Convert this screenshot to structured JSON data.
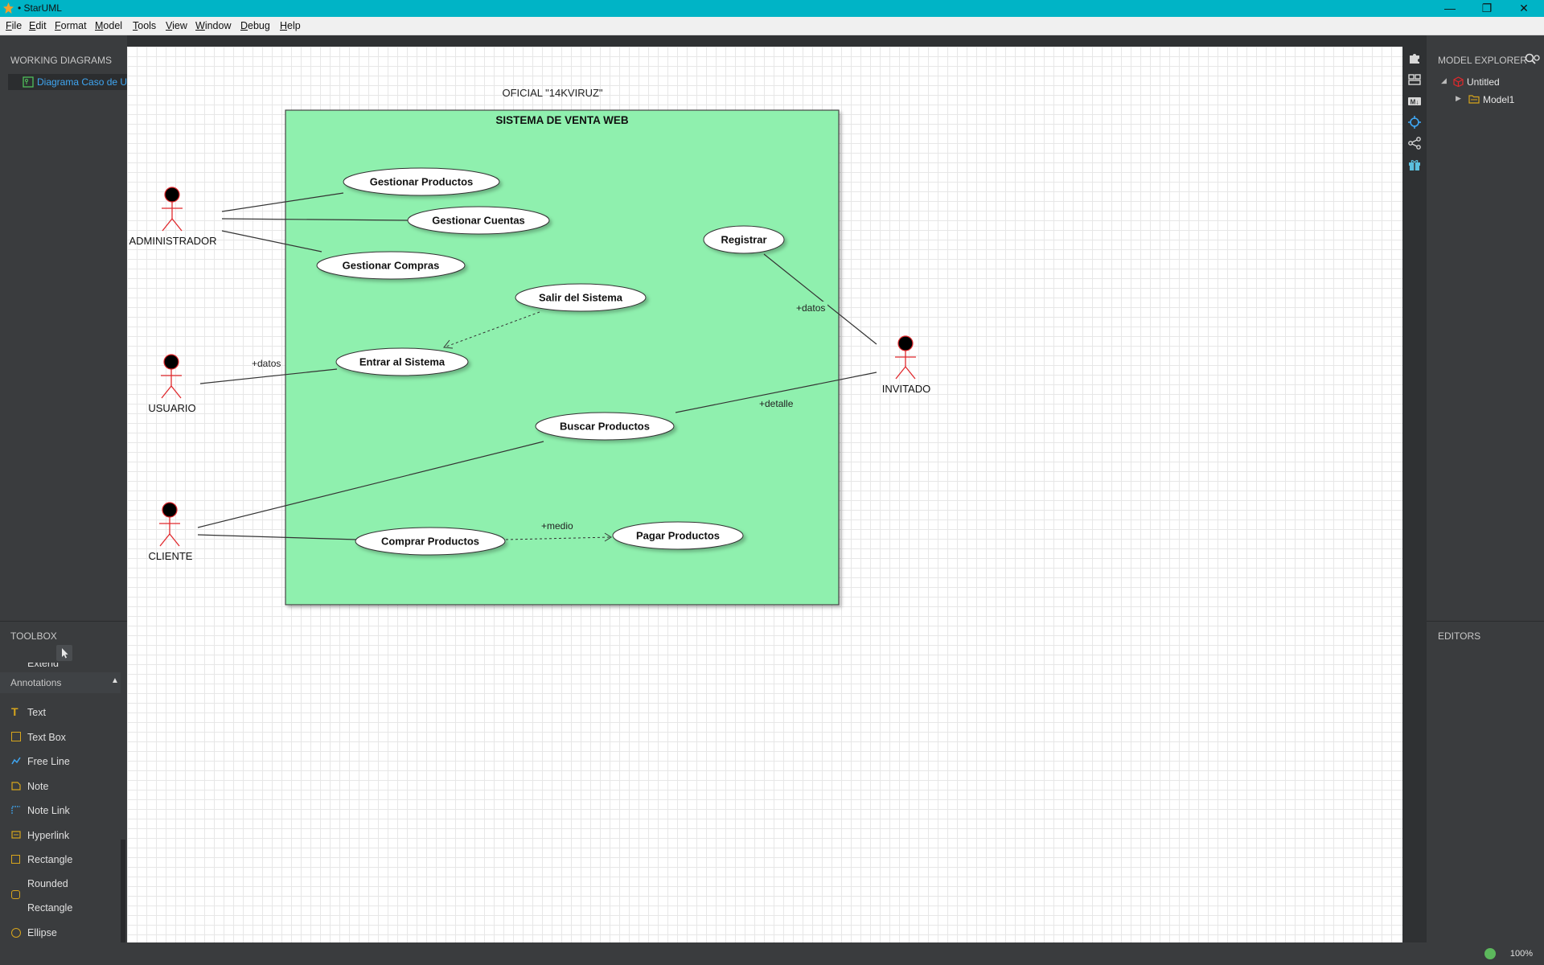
{
  "window": {
    "title": "• StarUML",
    "min": "—",
    "max": "❐",
    "close": "✕"
  },
  "menu": [
    "File",
    "Edit",
    "Format",
    "Model",
    "Tools",
    "View",
    "Window",
    "Debug",
    "Help"
  ],
  "working_diagrams": {
    "title": "WORKING DIAGRAMS",
    "item": "Diagrama Caso de Uso"
  },
  "toolbox": {
    "title": "TOOLBOX",
    "partial_item": "Extend",
    "section": "Annotations",
    "items": [
      {
        "label": "Text",
        "icon": "text-icon"
      },
      {
        "label": "Text Box",
        "icon": "text-box-icon"
      },
      {
        "label": "Free Line",
        "icon": "free-line-icon"
      },
      {
        "label": "Note",
        "icon": "note-icon"
      },
      {
        "label": "Note Link",
        "icon": "note-link-icon"
      },
      {
        "label": "Hyperlink",
        "icon": "hyperlink-icon"
      },
      {
        "label": "Rectangle",
        "icon": "rectangle-icon"
      },
      {
        "label": "Rounded",
        "icon": "rounded-rectangle-icon"
      },
      {
        "label": "Ellipse",
        "icon": "ellipse-icon"
      }
    ],
    "rounded_line2": "Rectangle"
  },
  "model_explorer": {
    "title": "MODEL EXPLORER",
    "root": "Untitled",
    "child": "Model1"
  },
  "editors": {
    "title": "EDITORS"
  },
  "status": {
    "zoom": "100%"
  },
  "diagram": {
    "top_label": "OFICIAL \"14KVIRUZ\"",
    "system_name": "SISTEMA  DE  VENTA WEB",
    "colors": {
      "system_fill": "#8ff0ae",
      "actor_head": "#000000",
      "actor_body": "#e0282c"
    },
    "actors": {
      "administrador": "ADMINISTRADOR",
      "usuario": "USUARIO",
      "cliente": "CLIENTE",
      "invitado": "INVITADO"
    },
    "use_cases": {
      "gestionar_productos": "Gestionar Productos",
      "gestionar_cuentas": "Gestionar Cuentas",
      "gestionar_compras": "Gestionar Compras",
      "registrar": "Registrar",
      "salir": "Salir del Sistema",
      "entrar": "Entrar al Sistema",
      "buscar": "Buscar Productos",
      "comprar": "Comprar Productos",
      "pagar": "Pagar Productos"
    },
    "labels": {
      "datos_invitado": "+datos",
      "datos_usuario": "+datos",
      "detalle": "+detalle",
      "medio": "+medio"
    }
  }
}
